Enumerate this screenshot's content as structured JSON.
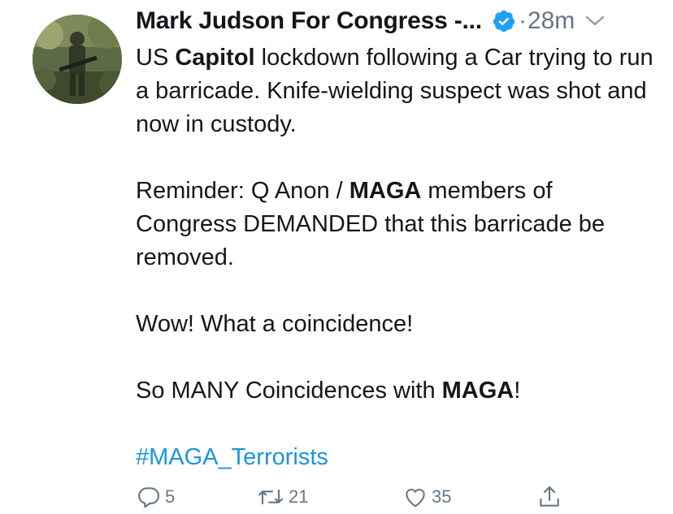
{
  "tweet": {
    "author": {
      "display_name": "Mark Judson For Congress -...",
      "verified": true,
      "verified_color": "#1da1f2",
      "avatar_icon": "avatar-photo"
    },
    "separator": "·",
    "time": "28m",
    "body": {
      "line1_pre": "US ",
      "line1_bold": "Capitol",
      "line1_post": " lockdown following a Car trying to run a barricade.  Knife-wielding suspect was shot and now in custody.",
      "line2_pre": "Reminder: Q Anon / ",
      "line2_bold": "MAGA",
      "line2_post": " members of Congress DEMANDED that this barricade be removed.",
      "line3": "Wow! What a coincidence!",
      "line4_pre": "So MANY Coincidences with ",
      "line4_bold": "MAGA",
      "line4_post": "!",
      "hashtag": "#MAGA_Terrorists"
    },
    "actions": {
      "reply_count": "5",
      "retweet_count": "21",
      "like_count": "35"
    },
    "colors": {
      "text": "#14171a",
      "secondary": "#657786",
      "link": "#1b95e0"
    }
  }
}
